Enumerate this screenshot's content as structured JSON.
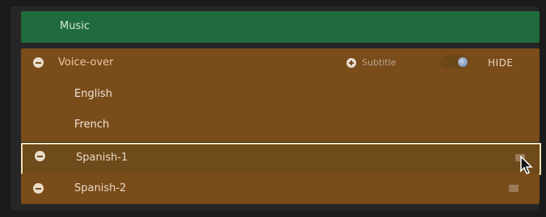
{
  "music": {
    "label": "Music"
  },
  "voice_over": {
    "label": "Voice-over",
    "subtitle_label": "Subtitle",
    "hide_label": "HIDE",
    "languages": [
      "English",
      "French"
    ]
  },
  "tracks": [
    {
      "label": "Spanish-1",
      "selected": true
    },
    {
      "label": "Spanish-2",
      "selected": false
    }
  ],
  "colors": {
    "music_bar": "#1f6b3d",
    "voice_over_group": "#7a4c1a",
    "selection_border": "#f0e0b3"
  },
  "icons": {
    "collapse": "minus-circle-icon",
    "add": "plus-circle-icon",
    "cursor": "arrow-pointer-icon"
  }
}
